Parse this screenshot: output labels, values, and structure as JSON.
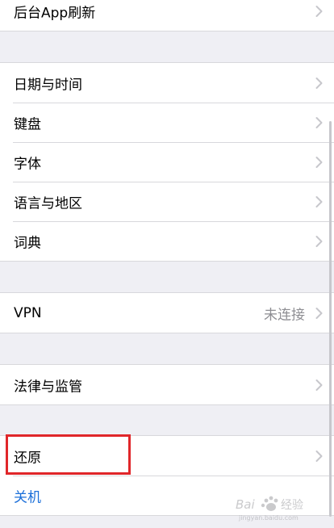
{
  "rows": {
    "background_refresh": "后台App刷新",
    "date_time": "日期与时间",
    "keyboard": "键盘",
    "fonts": "字体",
    "language_region": "语言与地区",
    "dictionary": "词典",
    "vpn": "VPN",
    "vpn_status": "未连接",
    "legal_regulatory": "法律与监管",
    "reset": "还原",
    "shutdown": "关机"
  },
  "colors": {
    "background": "#efeff4",
    "row": "#ffffff",
    "separator": "#d8d8dc",
    "link": "#1b6fd9",
    "highlight": "#e0262a"
  },
  "icons": {
    "disclosure": "chevron-right-icon",
    "watermark": "baidu-jingyan-watermark"
  },
  "watermark": {
    "text": "Baidu 经验",
    "sub": "jingyan.baidu.com"
  }
}
